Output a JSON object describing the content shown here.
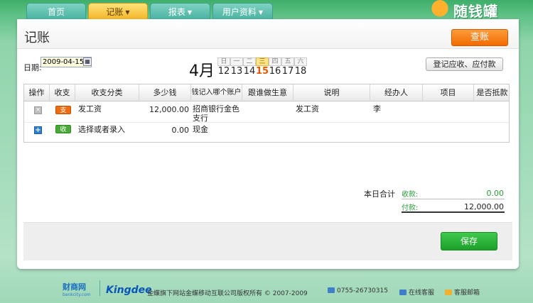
{
  "nav": {
    "tabs": [
      {
        "label": "首页",
        "has_dropdown": false
      },
      {
        "label": "记账",
        "has_dropdown": true,
        "active": true
      },
      {
        "label": "报表",
        "has_dropdown": true
      },
      {
        "label": "用户资料",
        "has_dropdown": true
      }
    ],
    "logo_text": "随钱罐"
  },
  "header": {
    "title": "记账",
    "query_button": "查账"
  },
  "toolbar": {
    "date_label": "日期:",
    "date_value": "2009-04-15",
    "month_label": "4月",
    "days": [
      {
        "weekday": "日",
        "day": "12"
      },
      {
        "weekday": "一",
        "day": "13"
      },
      {
        "weekday": "二",
        "day": "14"
      },
      {
        "weekday": "三",
        "day": "15",
        "today": true
      },
      {
        "weekday": "四",
        "day": "16"
      },
      {
        "weekday": "五",
        "day": "17"
      },
      {
        "weekday": "六",
        "day": "18"
      }
    ],
    "register_button": "登记应收、应付款"
  },
  "table": {
    "columns": [
      "操作",
      "收支",
      "收支分类",
      "多少钱",
      "钱记入哪个账户",
      "跟谁做生意",
      "说明",
      "经办人",
      "项目",
      "是否抵款"
    ],
    "rows": [
      {
        "action": "delete",
        "type": "支",
        "category": "发工资",
        "amount": "12,000.00",
        "account": "招商银行金色支行",
        "partner": "",
        "note": "发工资",
        "handler": "李",
        "project": "",
        "offset": ""
      },
      {
        "action": "add",
        "type": "收",
        "category": "选择或者录入",
        "amount": "0.00",
        "account": "现金",
        "partner": "",
        "note": "",
        "handler": "",
        "project": "",
        "offset": ""
      }
    ]
  },
  "totals": {
    "label": "本日合计",
    "income_label": "收款:",
    "income_value": "0.00",
    "expense_label": "付款:",
    "expense_value": "12,000.00"
  },
  "actions": {
    "save_button": "保存"
  },
  "footer": {
    "logo1": "财商网",
    "logo1_sub": "bankcity.com",
    "logo2": "Kingdee",
    "copyright": "金蝶旗下网站金蝶移动互联公司版权所有 © 2007-2009",
    "phone": "0755-26730315",
    "service": "在线客服",
    "mail": "客服邮箱"
  },
  "colors": {
    "accent_orange": "#f26b00",
    "accent_green": "#1c9f2a",
    "income_green": "#2b9a3a"
  }
}
